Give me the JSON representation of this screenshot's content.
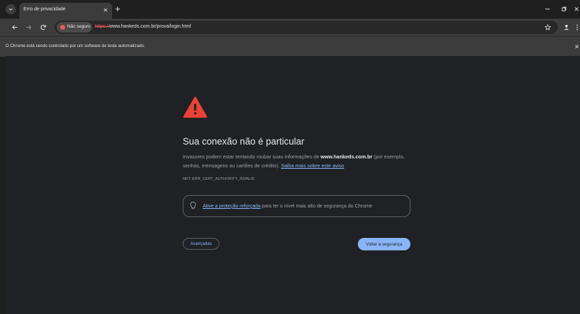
{
  "tab": {
    "title": "Erro de privacidade"
  },
  "toolbar": {
    "security_chip": "Não seguro",
    "url_scheme": "https://",
    "url_rest": "www.hankeds.com.br/prova/login.html"
  },
  "infobar": {
    "message": "O Chrome está sendo controlado por um software de teste automatizado."
  },
  "interstitial": {
    "heading": "Sua conexão não é particular",
    "body_prefix": "Invasores podem estar tentando roubar suas informações de ",
    "domain": "www.hankeds.com.br",
    "body_suffix": " (por exemplo, senhas, mensagens ou cartões de crédito). ",
    "learn_more": "Saiba mais sobre este aviso",
    "error_code": "NET::ERR_CERT_AUTHORITY_INVALID",
    "protection_link": "Ative a proteção reforçada",
    "protection_text": " para ter o nível mais alto de segurança do Chrome",
    "advanced_button": "Avançadas",
    "back_button": "Voltar à segurança"
  },
  "colors": {
    "background": "#202124",
    "accent": "#8ab4f8",
    "warning": "#ea4335",
    "insecure": "#ea5a5a"
  },
  "icons": {
    "warning": "warning-triangle-icon",
    "bulb": "lightbulb-icon"
  }
}
